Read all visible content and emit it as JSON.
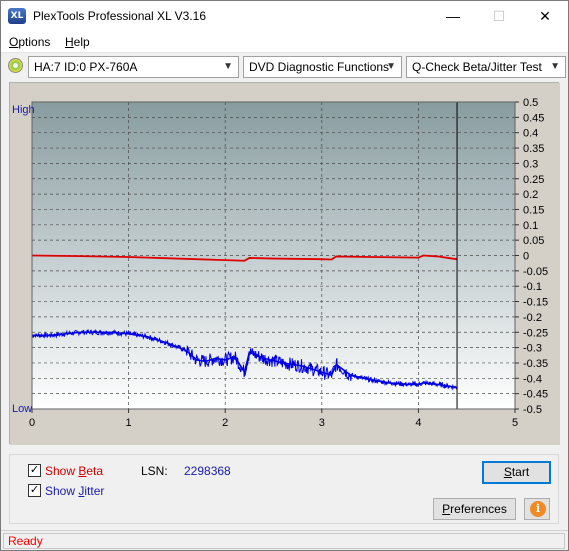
{
  "window": {
    "title": "PlexTools Professional XL V3.16",
    "app_icon_text": "XL",
    "minimize_glyph": "—",
    "maximize_glyph": "☐",
    "close_glyph": "✕"
  },
  "menu": {
    "items": [
      {
        "label": "Options",
        "mnemonic": "O"
      },
      {
        "label": "Help",
        "mnemonic": "H"
      }
    ]
  },
  "toolbar": {
    "drive": "HA:7 ID:0  PX-760A",
    "function": "DVD Diagnostic Functions",
    "test": "Q-Check Beta/Jitter Test"
  },
  "chart": {
    "left_top_label": "High",
    "left_bottom_label": "Low",
    "x_ticks": [
      "0",
      "1",
      "2",
      "3",
      "4",
      "5"
    ],
    "y_right_ticks": [
      "0.5",
      "0.45",
      "0.4",
      "0.35",
      "0.3",
      "0.25",
      "0.2",
      "0.15",
      "0.1",
      "0.05",
      "0",
      "-0.05",
      "-0.1",
      "-0.15",
      "-0.2",
      "-0.25",
      "-0.3",
      "-0.35",
      "-0.4",
      "-0.45",
      "-0.5"
    ],
    "colors": {
      "beta": "#e00000",
      "jitter": "#0000e0",
      "bg_top": "#889ca0",
      "bg_bottom": "#ffffff",
      "cursor": "#000000"
    }
  },
  "chart_data": {
    "type": "line",
    "xlabel": "",
    "ylabel": "",
    "xlim": [
      0,
      5
    ],
    "ylim": [
      -0.5,
      0.5
    ],
    "cursor_x": 4.4,
    "series": [
      {
        "name": "Beta",
        "x": [
          0,
          0.5,
          1.0,
          1.5,
          2.0,
          2.2,
          2.25,
          2.5,
          3.0,
          3.1,
          3.15,
          3.5,
          3.8,
          4.0,
          4.05,
          4.2,
          4.35,
          4.4
        ],
        "values": [
          0.0,
          -0.002,
          -0.005,
          -0.01,
          -0.015,
          -0.017,
          -0.008,
          -0.01,
          -0.012,
          -0.013,
          -0.003,
          -0.005,
          -0.006,
          -0.007,
          0.0,
          -0.003,
          -0.01,
          -0.012
        ]
      },
      {
        "name": "Jitter",
        "x": [
          0,
          0.2,
          0.5,
          0.8,
          1.0,
          1.2,
          1.4,
          1.6,
          1.7,
          1.8,
          1.9,
          2.0,
          2.1,
          2.2,
          2.25,
          2.4,
          2.6,
          2.8,
          3.0,
          3.1,
          3.15,
          3.3,
          3.5,
          3.7,
          3.9,
          4.0,
          4.05,
          4.2,
          4.4
        ],
        "values": [
          -0.26,
          -0.26,
          -0.25,
          -0.25,
          -0.255,
          -0.265,
          -0.285,
          -0.31,
          -0.34,
          -0.345,
          -0.335,
          -0.34,
          -0.33,
          -0.38,
          -0.315,
          -0.335,
          -0.35,
          -0.36,
          -0.38,
          -0.39,
          -0.355,
          -0.39,
          -0.405,
          -0.415,
          -0.42,
          -0.42,
          -0.415,
          -0.42,
          -0.43
        ]
      }
    ]
  },
  "controls": {
    "show_beta_label": "Show Beta",
    "show_beta_checked": true,
    "show_jitter_label": "Show Jitter",
    "show_jitter_checked": true,
    "lsn_label": "LSN:",
    "lsn_value": "2298368",
    "start_label": "Start",
    "preferences_label": "Preferences",
    "info_glyph": "i",
    "check_glyph": "✓"
  },
  "status": {
    "text": "Ready"
  }
}
